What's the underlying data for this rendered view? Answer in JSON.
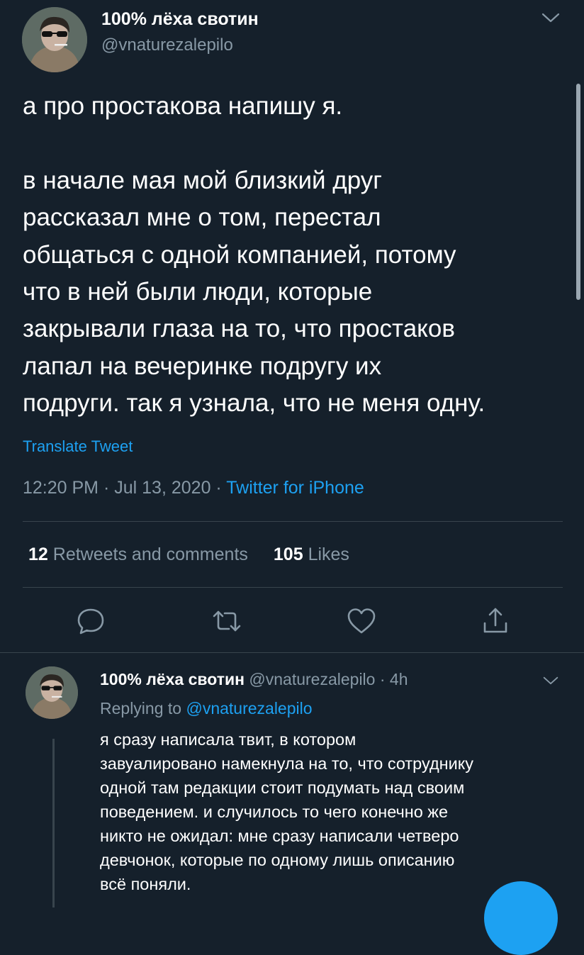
{
  "main_tweet": {
    "display_name": "100% лёха свотин",
    "handle": "@vnaturezalepilo",
    "text": "а про простакова напишу я.\n\nв начале мая мой близкий друг\nрассказал мне о том, перестал\nобщаться с одной компанией, потому\nчто в ней были люди, которые\nзакрывали глаза на то, что простаков\nлапал на вечеринке подругу их\nподруги. так я узнала, что не меня одну.",
    "translate_label": "Translate Tweet",
    "time": "12:20 PM",
    "date": "Jul 13, 2020",
    "separator": "·",
    "source": "Twitter for iPhone",
    "retweets_count": "12",
    "retweets_label": "Retweets and comments",
    "likes_count": "105",
    "likes_label": "Likes"
  },
  "actions": {
    "reply_icon": "comment-icon",
    "retweet_icon": "retweet-icon",
    "like_icon": "heart-icon",
    "share_icon": "share-icon"
  },
  "reply_tweet": {
    "display_name": "100% лёха свотин",
    "handle": "@vnaturezalepilo",
    "separator": "·",
    "time": "4h",
    "replying_prefix": "Replying to",
    "replying_to": "@vnaturezalepilo",
    "text": "я сразу написала твит, в котором\nзавуалировано намекнула на то, что сотруднику\nодной там редакции стоит подумать над своим\nповедением. и случилось то чего конечно же\nникто не ожидал: мне сразу написали четверо\nдевчонок, которые по одному лишь описанию\nвсё поняли."
  },
  "colors": {
    "background": "#15202b",
    "text_primary": "#ffffff",
    "text_secondary": "#8899a6",
    "accent": "#1da1f2",
    "divider": "#38444d"
  }
}
